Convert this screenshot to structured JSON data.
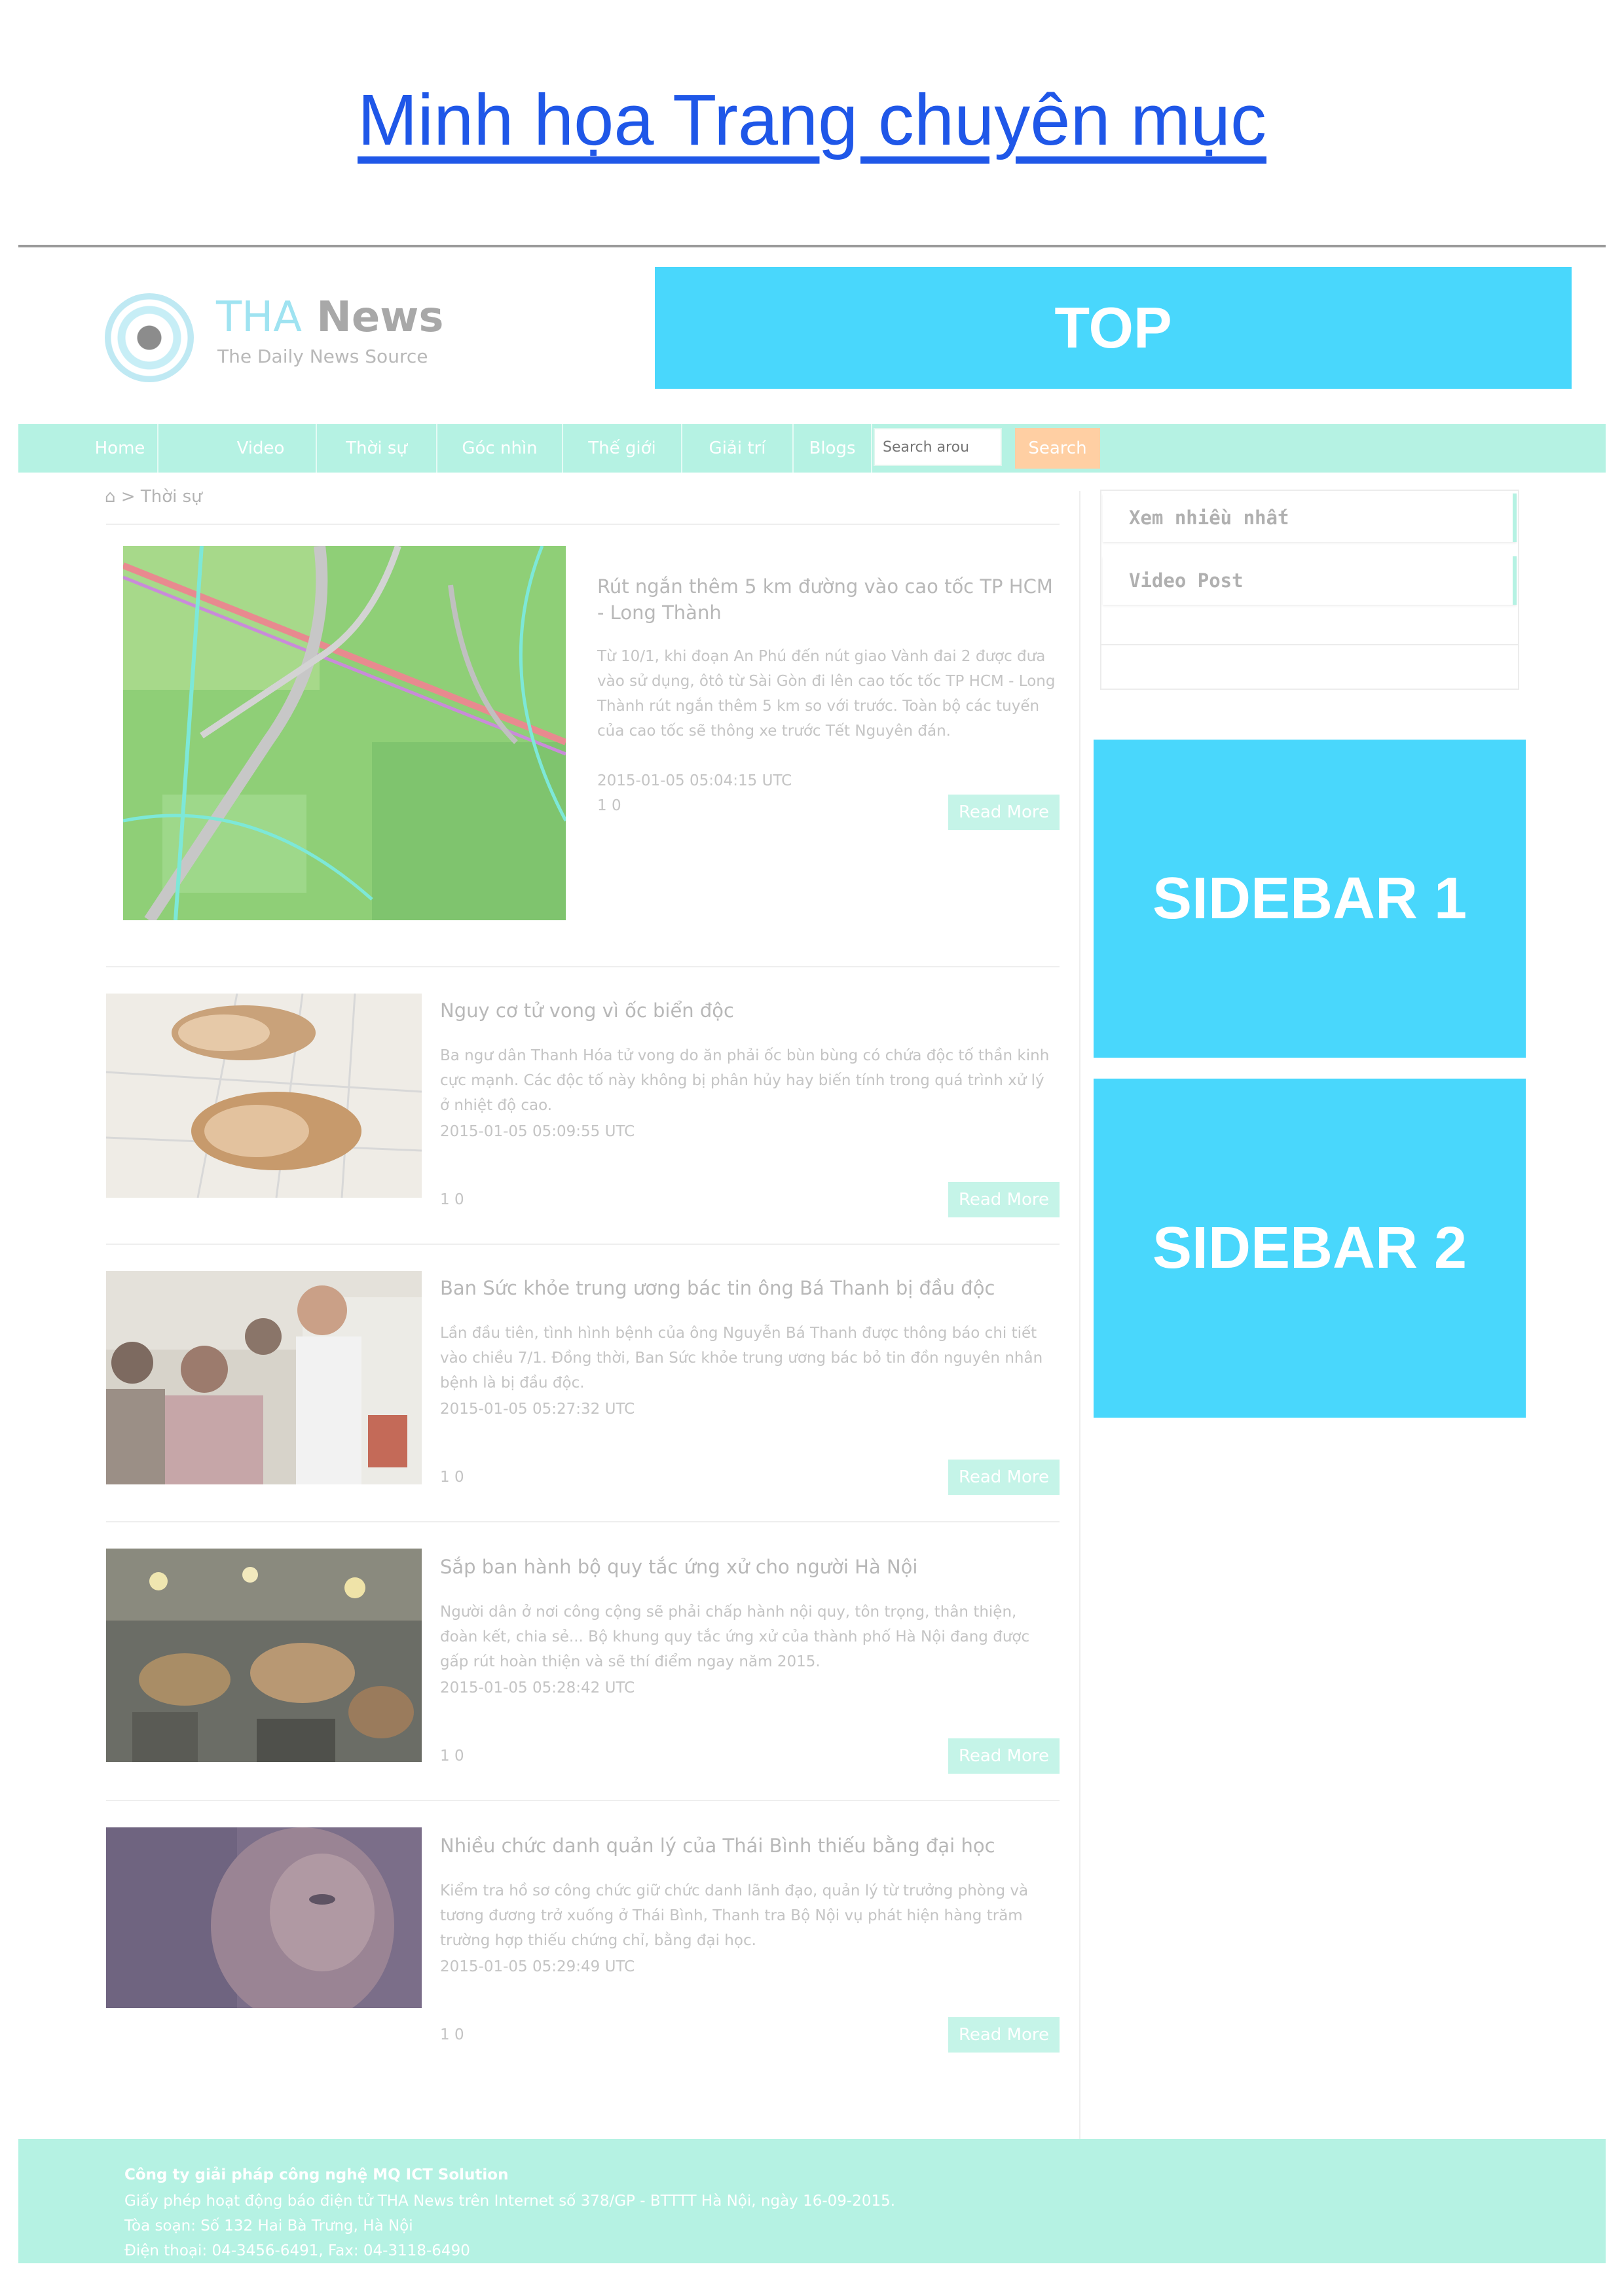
{
  "document_title": "Minh họa Trang chuyên mục",
  "header": {
    "logo_part1": "THA",
    "logo_part2": "News",
    "tagline": "The Daily News Source"
  },
  "zones": {
    "top": "TOP",
    "sidebar1": "SIDEBAR 1",
    "sidebar2": "SIDEBAR 2"
  },
  "nav": {
    "items": [
      "Home",
      "Video",
      "Thời sự",
      "Góc nhìn",
      "Thế giới",
      "Giải trí",
      "Blogs"
    ],
    "search_placeholder": "Search arou",
    "search_button": "Search"
  },
  "breadcrumb": {
    "separator": ">",
    "current": "Thời sự"
  },
  "sidebar_widget": {
    "tabs": [
      "Xem nhiều nhất",
      "Video Post"
    ]
  },
  "articles": [
    {
      "title": "Rút ngắn thêm 5 km đường vào cao tốc TP HCM - Long Thành",
      "summary": "Từ 10/1, khi đoạn An Phú đến nút giao Vành đai 2 được đưa vào sử dụng, ôtô từ Sài Gòn đi lên cao tốc tốc TP HCM - Long Thành rút ngắn thêm 5 km so với trước. Toàn bộ các tuyến của cao tốc sẽ thông xe trước Tết Nguyên đán.",
      "date": "2015-01-05 05:04:15 UTC",
      "count": "1 0",
      "read_more": "Read More"
    },
    {
      "title": "Nguy cơ tử vong vì ốc biển độc",
      "summary": "Ba ngư dân Thanh Hóa tử vong do ăn phải ốc bùn bùng có chứa độc tố thần kinh cực mạnh. Các độc tố này không bị phân hủy hay biến tính trong quá trình xử lý ở nhiệt độ cao.",
      "date": "2015-01-05 05:09:55 UTC",
      "count": "1 0",
      "read_more": "Read More"
    },
    {
      "title": "Ban Sức khỏe trung ương bác tin ông Bá Thanh bị đầu độc",
      "summary": "Lần đầu tiên, tình hình bệnh của ông Nguyễn Bá Thanh được thông báo chi tiết vào chiều 7/1. Đồng thời, Ban Sức khỏe trung ương bác bỏ tin đồn nguyên nhân bệnh là bị đầu độc.",
      "date": "2015-01-05 05:27:32 UTC",
      "count": "1 0",
      "read_more": "Read More"
    },
    {
      "title": "Sắp ban hành bộ quy tắc ứng xử cho người Hà Nội",
      "summary": "Người dân ở nơi công cộng sẽ phải chấp hành nội quy, tôn trọng, thân thiện, đoàn kết, chia sẻ... Bộ khung quy tắc ứng xử của thành phố Hà Nội đang được gấp rút hoàn thiện và sẽ thí điểm ngay năm 2015.",
      "date": "2015-01-05 05:28:42 UTC",
      "count": "1 0",
      "read_more": "Read More"
    },
    {
      "title": "Nhiều chức danh quản lý của Thái Bình thiếu bằng đại học",
      "summary": "Kiểm tra hồ sơ công chức giữ chức danh lãnh đạo, quản lý từ trưởng phòng và tương đương trở xuống ở Thái Bình, Thanh tra Bộ Nội vụ phát hiện hàng trăm trường hợp thiếu chứng chỉ, bằng đại học.",
      "date": "2015-01-05 05:29:49 UTC",
      "count": "1 0",
      "read_more": "Read More"
    }
  ],
  "footer": {
    "company": "Công ty giải pháp công nghệ MQ ICT Solution",
    "license": "Giấy phép hoạt động báo điện tử THA News trên Internet số 378/GP - BTTTT Hà Nội, ngày 16-09-2015.",
    "address": "Tòa soạn: Số 132 Hai Bà Trưng, Hà Nội",
    "phone": "Điện thoại: 04-3456-6491, Fax: 04-3118-6490"
  },
  "colors": {
    "zone": "#49d7fc",
    "nav": "#b5f2e3",
    "title_link": "#1f57e8",
    "search_button": "#ffcfa3"
  }
}
